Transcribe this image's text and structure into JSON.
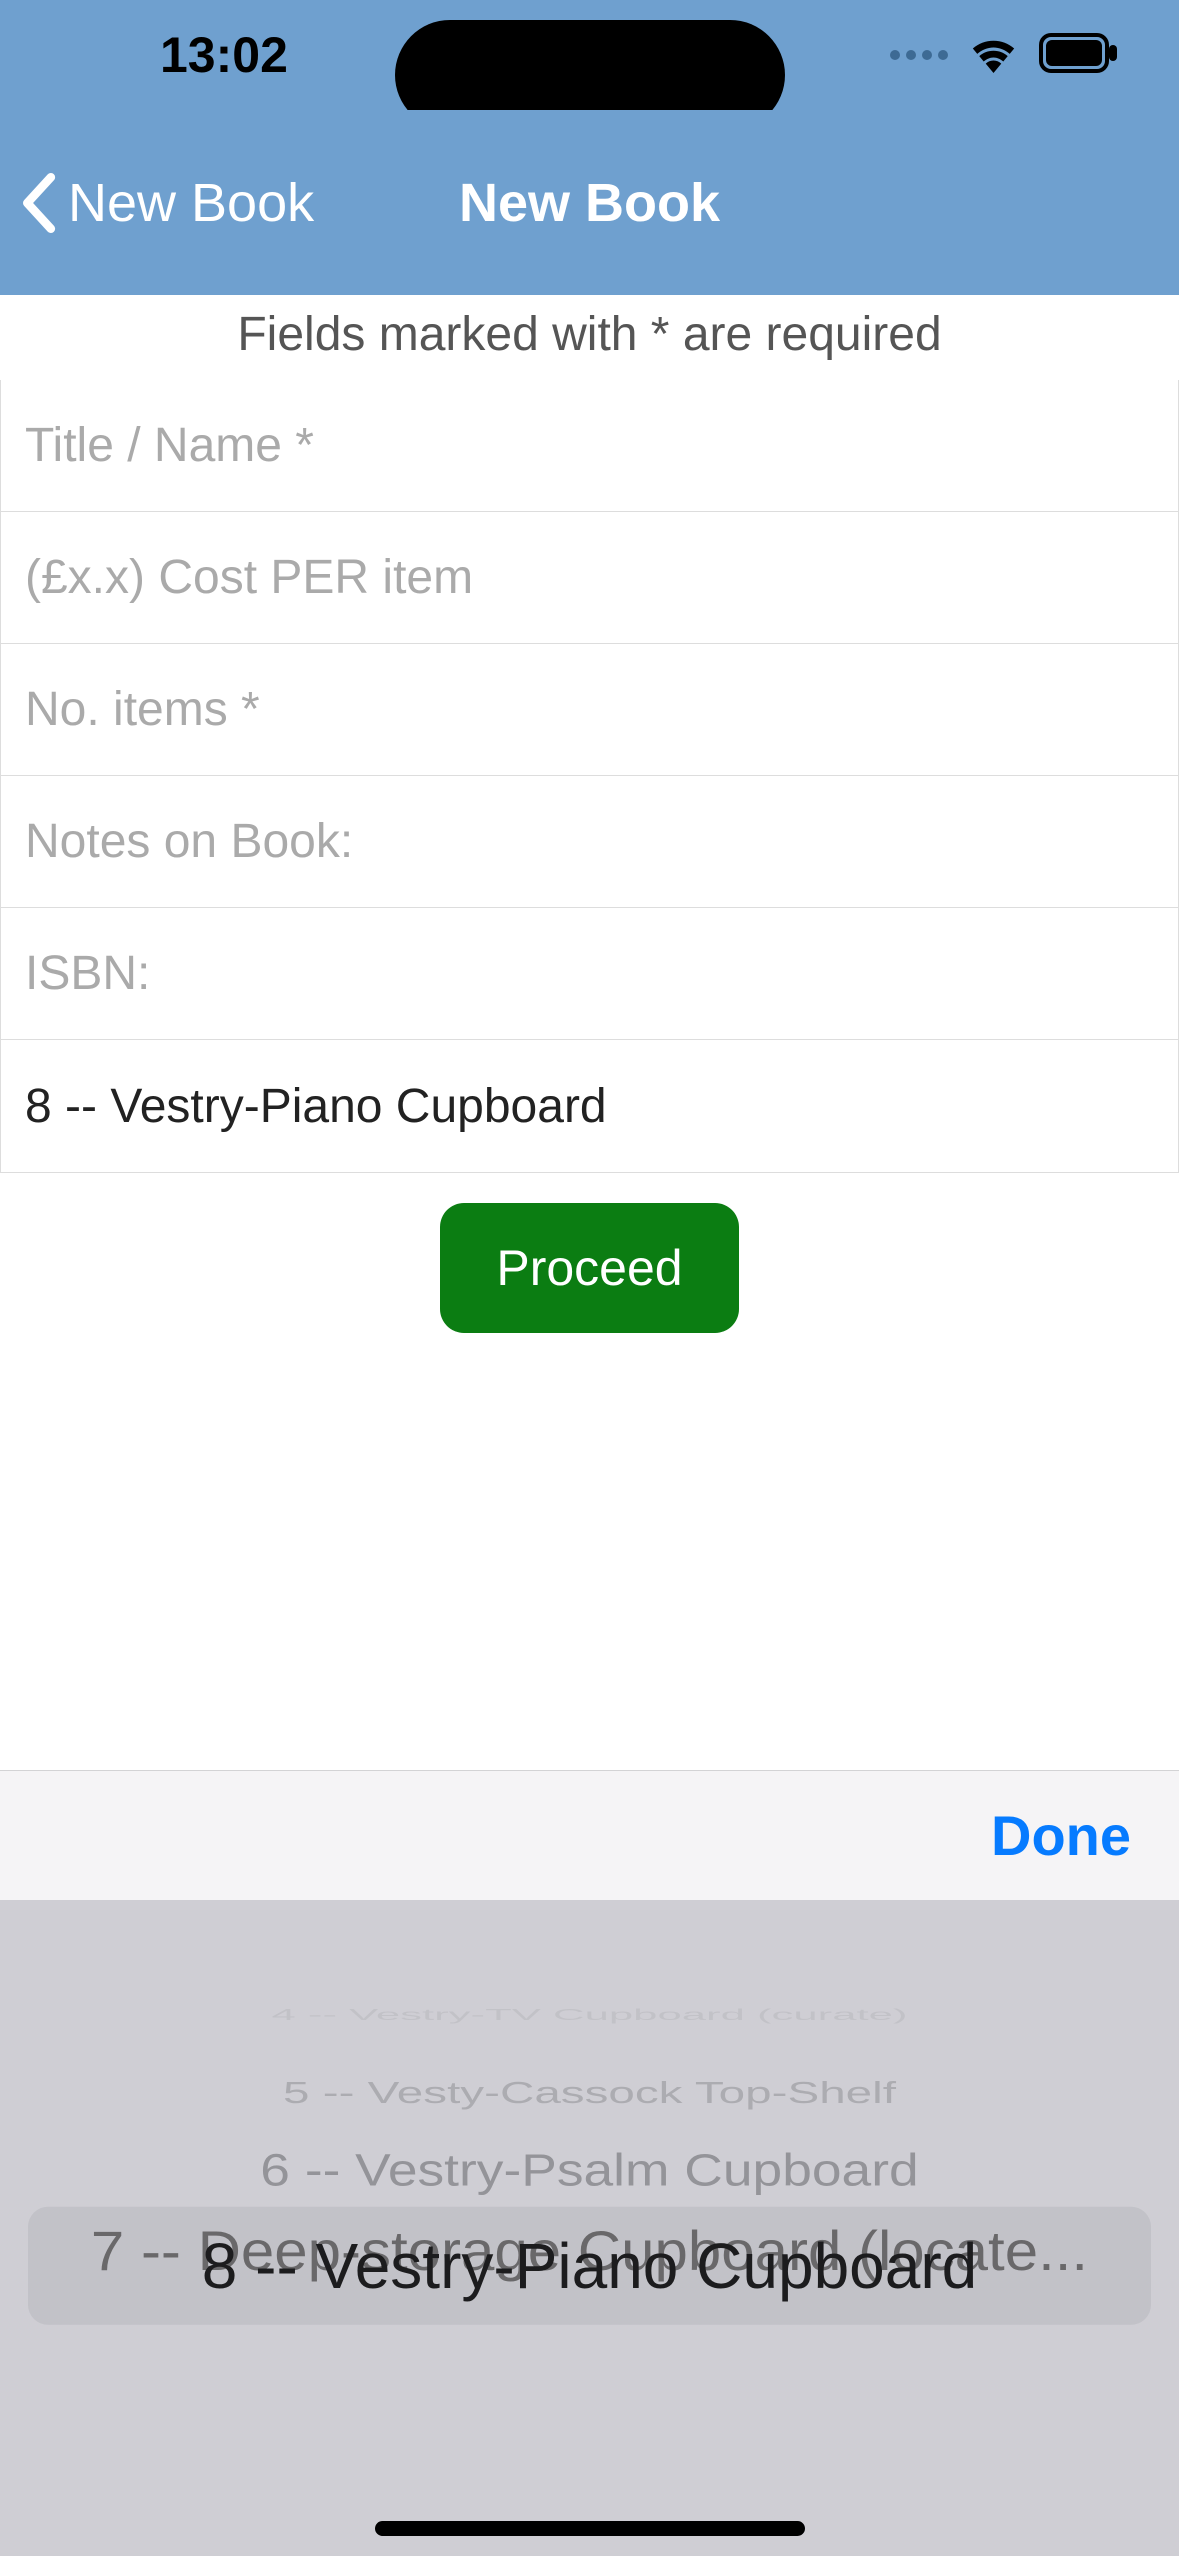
{
  "status": {
    "time": "13:02"
  },
  "nav": {
    "back_label": "New Book",
    "title": "New Book"
  },
  "form": {
    "required_note": "Fields marked with * are required",
    "title": {
      "placeholder": "Title / Name *",
      "value": ""
    },
    "cost": {
      "placeholder": "(£x.x) Cost PER item",
      "value": ""
    },
    "items": {
      "placeholder": "No. items *",
      "value": ""
    },
    "notes": {
      "placeholder": "Notes on Book:",
      "value": ""
    },
    "isbn": {
      "placeholder": "ISBN:",
      "value": ""
    },
    "location_selected": "8 -- Vestry-Piano Cupboard",
    "proceed_label": "Proceed"
  },
  "accessory": {
    "done_label": "Done"
  },
  "picker": {
    "items": [
      "4 -- Vestry-TV Cupboard (curate)",
      "5 -- Vesty-Cassock Top-Shelf",
      "6 -- Vestry-Psalm Cupboard",
      "7 -- Deep-storage Cupboard (locate...",
      "8 -- Vestry-Piano Cupboard"
    ]
  }
}
